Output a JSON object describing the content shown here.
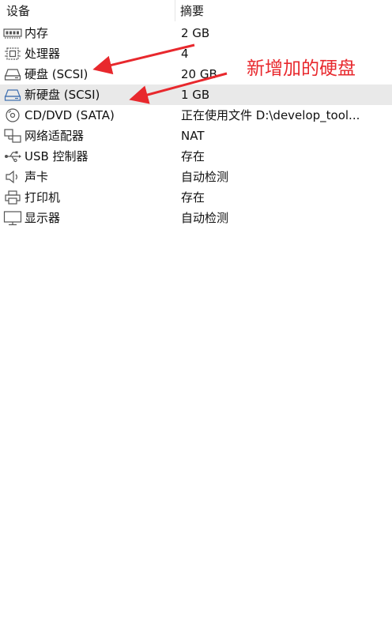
{
  "header": {
    "device_label": "设备",
    "summary_label": "摘要"
  },
  "devices": [
    {
      "name": "内存",
      "value": "2 GB",
      "icon": "memory-icon"
    },
    {
      "name": "处理器",
      "value": "4",
      "icon": "processor-icon"
    },
    {
      "name": "硬盘 (SCSI)",
      "value": "20 GB",
      "icon": "hard-disk-icon"
    },
    {
      "name": "新硬盘 (SCSI)",
      "value": "1 GB",
      "icon": "hard-disk-icon",
      "selected": true
    },
    {
      "name": "CD/DVD (SATA)",
      "value": "正在使用文件 D:\\develop_tool...",
      "icon": "cd-dvd-icon"
    },
    {
      "name": "网络适配器",
      "value": "NAT",
      "icon": "network-adapter-icon"
    },
    {
      "name": "USB 控制器",
      "value": "存在",
      "icon": "usb-icon"
    },
    {
      "name": "声卡",
      "value": "自动检测",
      "icon": "speaker-icon"
    },
    {
      "name": "打印机",
      "value": "存在",
      "icon": "printer-icon"
    },
    {
      "name": "显示器",
      "value": "自动检测",
      "icon": "monitor-icon"
    }
  ],
  "annotation": {
    "text": "新增加的硬盘",
    "color": "#e8282d"
  },
  "colors": {
    "selected_row": "#e9e9e9",
    "icon_stroke": "#555555",
    "selected_icon_stroke": "#3f6fb0"
  }
}
